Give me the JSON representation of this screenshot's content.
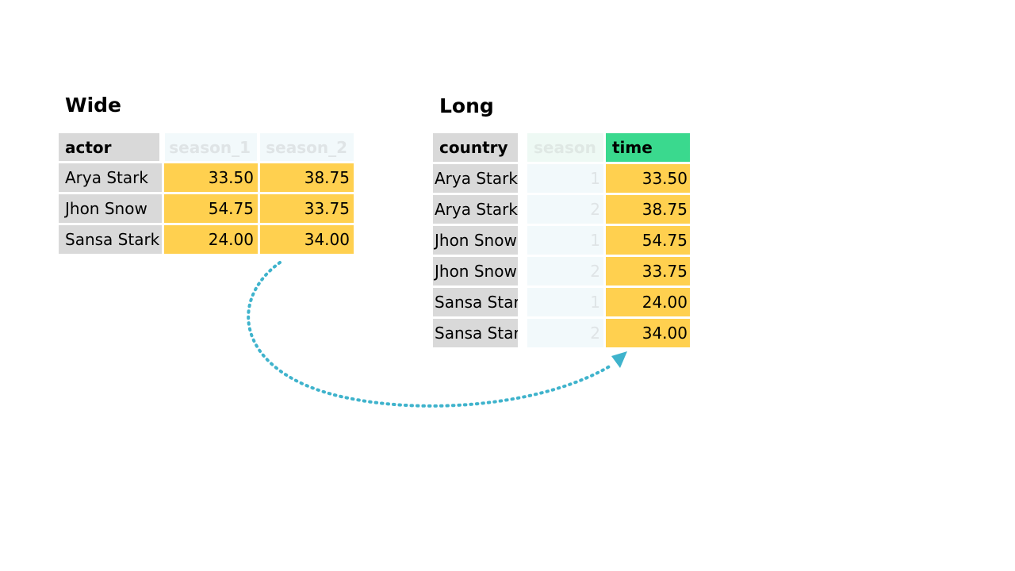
{
  "wide": {
    "title": "Wide",
    "headers": {
      "actor": "actor",
      "season_1": "season_1",
      "season_2": "season_2"
    },
    "rows": [
      {
        "actor": "Arya Stark",
        "season_1": "33.50",
        "season_2": "38.75"
      },
      {
        "actor": "Jhon Snow",
        "season_1": "54.75",
        "season_2": "33.75"
      },
      {
        "actor": "Sansa Stark",
        "season_1": "24.00",
        "season_2": "34.00"
      }
    ]
  },
  "long": {
    "title": "Long",
    "headers": {
      "country": "country",
      "season": "season",
      "time": "time"
    },
    "rows": [
      {
        "country": "Arya Stark",
        "season": "1",
        "time": "33.50"
      },
      {
        "country": "Arya Stark",
        "season": "2",
        "time": "38.75"
      },
      {
        "country": "Jhon Snow",
        "season": "1",
        "time": "54.75"
      },
      {
        "country": "Jhon Snow",
        "season": "2",
        "time": "33.75"
      },
      {
        "country": "Sansa Stark",
        "season": "1",
        "time": "24.00"
      },
      {
        "country": "Sansa Stark",
        "season": "2",
        "time": "34.00"
      }
    ]
  },
  "colors": {
    "label_gray": "#d9d9d9",
    "value_gold": "#ffd04f",
    "faded_column": "#f2f9fb",
    "highlight_header": "#3ad98e",
    "arrow": "#3fb3cc"
  },
  "arrow": {
    "icon": "curved-dotted-arrow-icon"
  }
}
